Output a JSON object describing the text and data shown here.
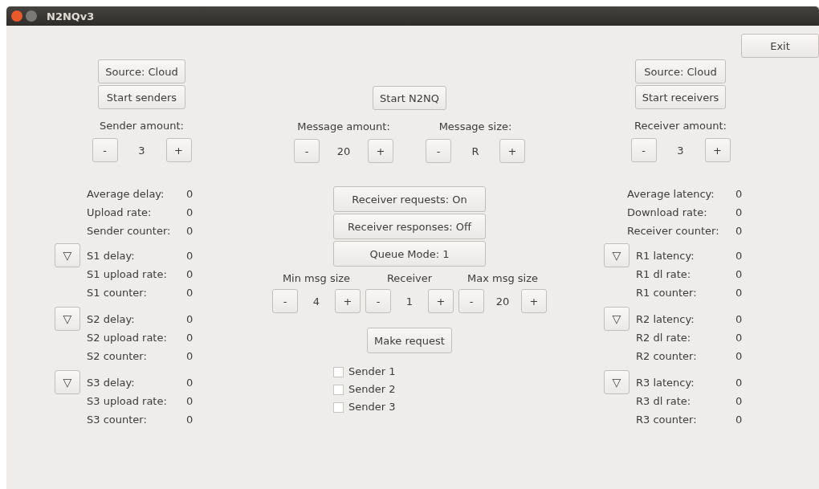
{
  "window": {
    "title": "N2NQv3"
  },
  "exit_button": "Exit",
  "senders": {
    "source_button": "Source: Cloud",
    "start_button": "Start senders",
    "amount": {
      "label": "Sender amount:",
      "minus": "-",
      "value": "3",
      "plus": "+"
    },
    "summary": [
      {
        "label": "Average delay:",
        "value": "0"
      },
      {
        "label": "Upload rate:",
        "value": "0"
      },
      {
        "label": "Sender counter:",
        "value": "0"
      }
    ],
    "items": [
      {
        "expand": "▽",
        "stats": [
          {
            "label": "S1 delay:",
            "value": "0"
          },
          {
            "label": "S1 upload rate:",
            "value": "0"
          },
          {
            "label": "S1 counter:",
            "value": "0"
          }
        ]
      },
      {
        "expand": "▽",
        "stats": [
          {
            "label": "S2 delay:",
            "value": "0"
          },
          {
            "label": "S2 upload rate:",
            "value": "0"
          },
          {
            "label": "S2 counter:",
            "value": "0"
          }
        ]
      },
      {
        "expand": "▽",
        "stats": [
          {
            "label": "S3 delay:",
            "value": "0"
          },
          {
            "label": "S3 upload rate:",
            "value": "0"
          },
          {
            "label": "S3 counter:",
            "value": "0"
          }
        ]
      }
    ]
  },
  "center": {
    "start_button": "Start N2NQ",
    "message_steppers": [
      {
        "label": "Message amount:",
        "minus": "-",
        "value": "20",
        "plus": "+"
      },
      {
        "label": "Message size:",
        "minus": "-",
        "value": "R",
        "plus": "+"
      }
    ],
    "toggles": [
      "Receiver requests: On",
      "Receiver responses: Off",
      "Queue Mode: 1"
    ],
    "request_steppers": [
      {
        "label": "Min msg size",
        "minus": "-",
        "value": "4",
        "plus": "+"
      },
      {
        "label": "Receiver",
        "minus": "-",
        "value": "1",
        "plus": "+"
      },
      {
        "label": "Max msg size",
        "minus": "-",
        "value": "20",
        "plus": "+"
      }
    ],
    "make_request_button": "Make request",
    "sender_checkboxes": [
      {
        "label": "Sender 1",
        "checked": false
      },
      {
        "label": "Sender 2",
        "checked": false
      },
      {
        "label": "Sender 3",
        "checked": false
      }
    ]
  },
  "receivers": {
    "source_button": "Source: Cloud",
    "start_button": "Start receivers",
    "amount": {
      "label": "Receiver amount:",
      "minus": "-",
      "value": "3",
      "plus": "+"
    },
    "summary": [
      {
        "label": "Average latency:",
        "value": "0"
      },
      {
        "label": "Download rate:",
        "value": "0"
      },
      {
        "label": "Receiver counter:",
        "value": "0"
      }
    ],
    "items": [
      {
        "expand": "▽",
        "stats": [
          {
            "label": "R1 latency:",
            "value": "0"
          },
          {
            "label": "R1 dl rate:",
            "value": "0"
          },
          {
            "label": "R1 counter:",
            "value": "0"
          }
        ]
      },
      {
        "expand": "▽",
        "stats": [
          {
            "label": "R2 latency:",
            "value": "0"
          },
          {
            "label": "R2 dl rate:",
            "value": "0"
          },
          {
            "label": "R2 counter:",
            "value": "0"
          }
        ]
      },
      {
        "expand": "▽",
        "stats": [
          {
            "label": "R3 latency:",
            "value": "0"
          },
          {
            "label": "R3 dl rate:",
            "value": "0"
          },
          {
            "label": "R3 counter:",
            "value": "0"
          }
        ]
      }
    ]
  }
}
